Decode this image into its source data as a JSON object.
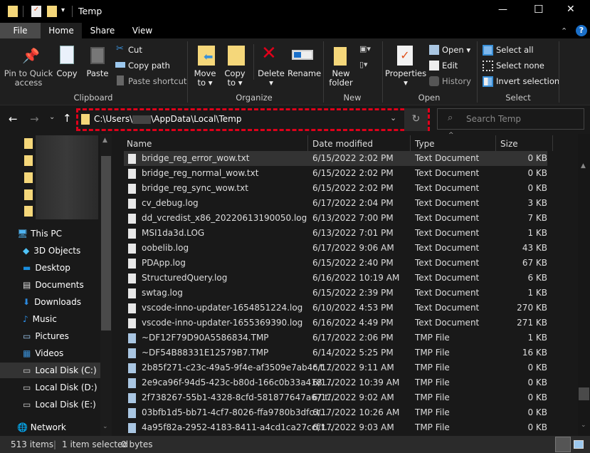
{
  "window": {
    "title": "Temp",
    "minimize": "—",
    "maximize": "☐",
    "close": "✕"
  },
  "tabs": [
    "File",
    "Home",
    "Share",
    "View"
  ],
  "ribbon": {
    "clipboard": {
      "group": "Clipboard",
      "pin": [
        "Pin to Quick",
        "access"
      ],
      "copy": "Copy",
      "paste": "Paste",
      "cut": "Cut",
      "copy_path": "Copy path",
      "paste_shortcut": "Paste shortcut"
    },
    "organize": {
      "group": "Organize",
      "move_to": [
        "Move",
        "to"
      ],
      "copy_to": [
        "Copy",
        "to"
      ],
      "delete": "Delete",
      "rename": "Rename"
    },
    "new": {
      "group": "New",
      "new_folder": [
        "New",
        "folder"
      ]
    },
    "open": {
      "group": "Open",
      "properties": "Properties",
      "open": "Open",
      "edit": "Edit",
      "history": "History"
    },
    "select": {
      "group": "Select",
      "select_all": "Select all",
      "select_none": "Select none",
      "invert": "Invert selection"
    }
  },
  "address": {
    "prefix": "C:\\Users\\",
    "suffix": "\\AppData\\Local\\Temp"
  },
  "search": {
    "placeholder": "Search Temp"
  },
  "nav": {
    "this_pc": "This PC",
    "items": [
      "3D Objects",
      "Desktop",
      "Documents",
      "Downloads",
      "Music",
      "Pictures",
      "Videos",
      "Local Disk (C:)",
      "Local Disk (D:)",
      "Local Disk (E:)"
    ],
    "network": "Network",
    "selected": "Local Disk (C:)"
  },
  "columns": {
    "name": "Name",
    "date": "Date modified",
    "type": "Type",
    "size": "Size"
  },
  "files": [
    [
      "bridge_reg_error_wow.txt",
      "6/15/2022 2:02 PM",
      "Text Document",
      "0 KB"
    ],
    [
      "bridge_reg_normal_wow.txt",
      "6/15/2022 2:02 PM",
      "Text Document",
      "0 KB"
    ],
    [
      "bridge_reg_sync_wow.txt",
      "6/15/2022 2:02 PM",
      "Text Document",
      "0 KB"
    ],
    [
      "cv_debug.log",
      "6/17/2022 2:04 PM",
      "Text Document",
      "3 KB"
    ],
    [
      "dd_vcredist_x86_20220613190050.log",
      "6/13/2022 7:00 PM",
      "Text Document",
      "7 KB"
    ],
    [
      "MSI1da3d.LOG",
      "6/13/2022 7:01 PM",
      "Text Document",
      "1 KB"
    ],
    [
      "oobelib.log",
      "6/17/2022 9:06 AM",
      "Text Document",
      "43 KB"
    ],
    [
      "PDApp.log",
      "6/15/2022 2:40 PM",
      "Text Document",
      "67 KB"
    ],
    [
      "StructuredQuery.log",
      "6/16/2022 10:19 AM",
      "Text Document",
      "6 KB"
    ],
    [
      "swtag.log",
      "6/15/2022 2:39 PM",
      "Text Document",
      "1 KB"
    ],
    [
      "vscode-inno-updater-1654851224.log",
      "6/10/2022 4:53 PM",
      "Text Document",
      "270 KB"
    ],
    [
      "vscode-inno-updater-1655369390.log",
      "6/16/2022 4:49 PM",
      "Text Document",
      "271 KB"
    ],
    [
      "~DF12F79D90A5586834.TMP",
      "6/17/2022 2:06 PM",
      "TMP File",
      "1 KB"
    ],
    [
      "~DF54B88331E12579B7.TMP",
      "6/14/2022 5:25 PM",
      "TMP File",
      "16 KB"
    ],
    [
      "2b85f271-c23c-49a5-9f4e-af3509e7ab4c.t...",
      "6/17/2022 9:11 AM",
      "TMP File",
      "0 KB"
    ],
    [
      "2e9ca96f-94d5-423c-b80d-166c0b33a418....",
      "6/17/2022 10:39 AM",
      "TMP File",
      "0 KB"
    ],
    [
      "2f738267-55b1-4328-8cfd-581877647a67.t...",
      "6/17/2022 9:02 AM",
      "TMP File",
      "0 KB"
    ],
    [
      "03bfb1d5-bb71-4cf7-8026-ffa9780b3dfc.t...",
      "6/17/2022 10:26 AM",
      "TMP File",
      "0 KB"
    ],
    [
      "4a95f82a-2952-4183-8411-a4cd1ca27ccf.t...",
      "6/17/2022 9:03 AM",
      "TMP File",
      "0 KB"
    ]
  ],
  "status": {
    "count": "513 items",
    "selected": "1 item selected",
    "size": "0 bytes"
  }
}
